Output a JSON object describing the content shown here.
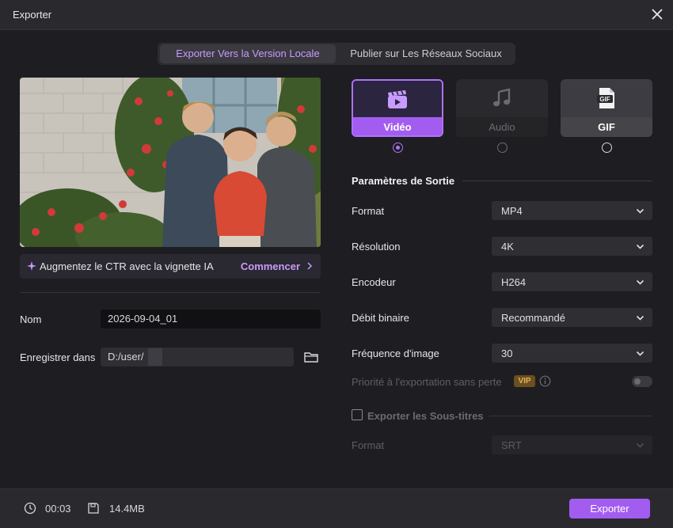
{
  "window": {
    "title": "Exporter"
  },
  "tabs": [
    {
      "label": "Exporter Vers la Version Locale",
      "active": true
    },
    {
      "label": "Publier sur Les Réseaux Sociaux",
      "active": false
    }
  ],
  "thumbnail_banner": {
    "text": "Augmentez le CTR avec la vignette IA",
    "action": "Commencer"
  },
  "left_form": {
    "name_label": "Nom",
    "name_value": "2026-09-04_01",
    "save_label": "Enregistrer dans",
    "save_value": "D:/user/"
  },
  "format_types": [
    {
      "label": "Vidéo",
      "selected": true,
      "icon": "video-clapper-icon"
    },
    {
      "label": "Audio",
      "selected": false,
      "icon": "music-note-icon"
    },
    {
      "label": "GIF",
      "selected": false,
      "icon": "gif-file-icon"
    }
  ],
  "output": {
    "section_title": "Paramètres de Sortie",
    "rows": [
      {
        "label": "Format",
        "value": "MP4"
      },
      {
        "label": "Résolution",
        "value": "4K"
      },
      {
        "label": "Encodeur",
        "value": "H264"
      },
      {
        "label": "Débit binaire",
        "value": "Recommandé"
      },
      {
        "label": "Fréquence d'image",
        "value": "30"
      }
    ],
    "lossless_label": "Priorité à l'exportation sans perte",
    "vip_badge": "VIP"
  },
  "subtitles": {
    "title": "Exporter les Sous-titres",
    "format_label": "Format",
    "format_value": "SRT"
  },
  "footer": {
    "duration": "00:03",
    "size": "14.4MB",
    "export_button": "Exporter"
  },
  "colors": {
    "accent": "#a35cf0",
    "accent_light": "#c89bff",
    "background": "#1e1e22"
  }
}
